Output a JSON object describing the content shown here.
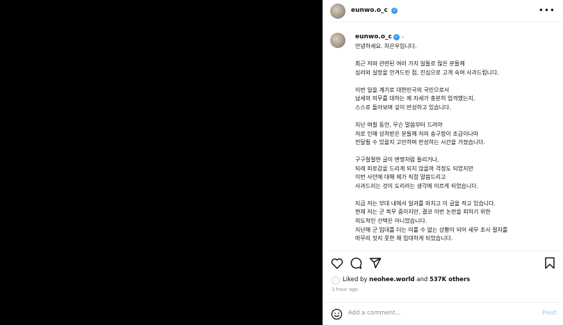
{
  "post": {
    "username": "eunwo.o_c",
    "caption_suffix": ".",
    "caption_lines": [
      "안녕하세요. 차은우입니다.",
      "",
      "최근 저와 관련된 여러 가지 일들로 많은 분들께",
      "심려와 실망을 안겨드린 점, 진심으로 고개 숙여 사과드립니다.",
      "",
      "이번 일을 계기로 대한민국의 국민으로서",
      "납세의 의무를 대하는 제 자세가 충분히 엄격했는지,",
      "스스로 돌아보며 깊이 반성하고 있습니다.",
      "",
      "지난 며칠 동안, 무슨 말씀부터 드려야",
      "저로 인해 상처받은 분들께 저의 송구함이 조금이나마",
      "전달될 수 있을지 고민하며 반성하는 시간을 가졌습니다.",
      "",
      "구구절절한 글이 변명처럼 들리거나,",
      "되레 피로감을 드리게 되지 않을까 걱정도 되었지만",
      "이번 사안에 대해 제가 직접 말씀드리고",
      "사과드리는 것이 도리라는 생각에 이르게 되었습니다.",
      "",
      "지금 저는 부대 내에서 일과를 마치고 이 글을 적고 있습니다.",
      "현재 저는 군 복무 중이지만, 결코 이번 논란을 피하기 위한",
      "의도적인 선택은 아니었습니다.",
      "지난해 군 입대를 더는 미룰 수 없는 상황이 되어 세무 조사 절차를",
      "마무리 짓지 못한 채 입대하게 되었습니다."
    ]
  },
  "likes": {
    "prefix": "Liked by ",
    "user": "neohee.world",
    "middle": " and ",
    "count": "537K others"
  },
  "timestamp": "1 hour ago",
  "comment": {
    "placeholder": "Add a comment...",
    "post_label": "Post"
  },
  "icons": {
    "more": "more-icon",
    "heart": "heart-icon",
    "comment": "comment-icon",
    "share": "share-icon",
    "bookmark": "bookmark-icon",
    "emoji": "emoji-icon",
    "verified": "verified-badge-icon"
  },
  "colors": {
    "verified": "#3897f0",
    "post_button": "#b2dffc",
    "muted": "#8e8e8e"
  }
}
